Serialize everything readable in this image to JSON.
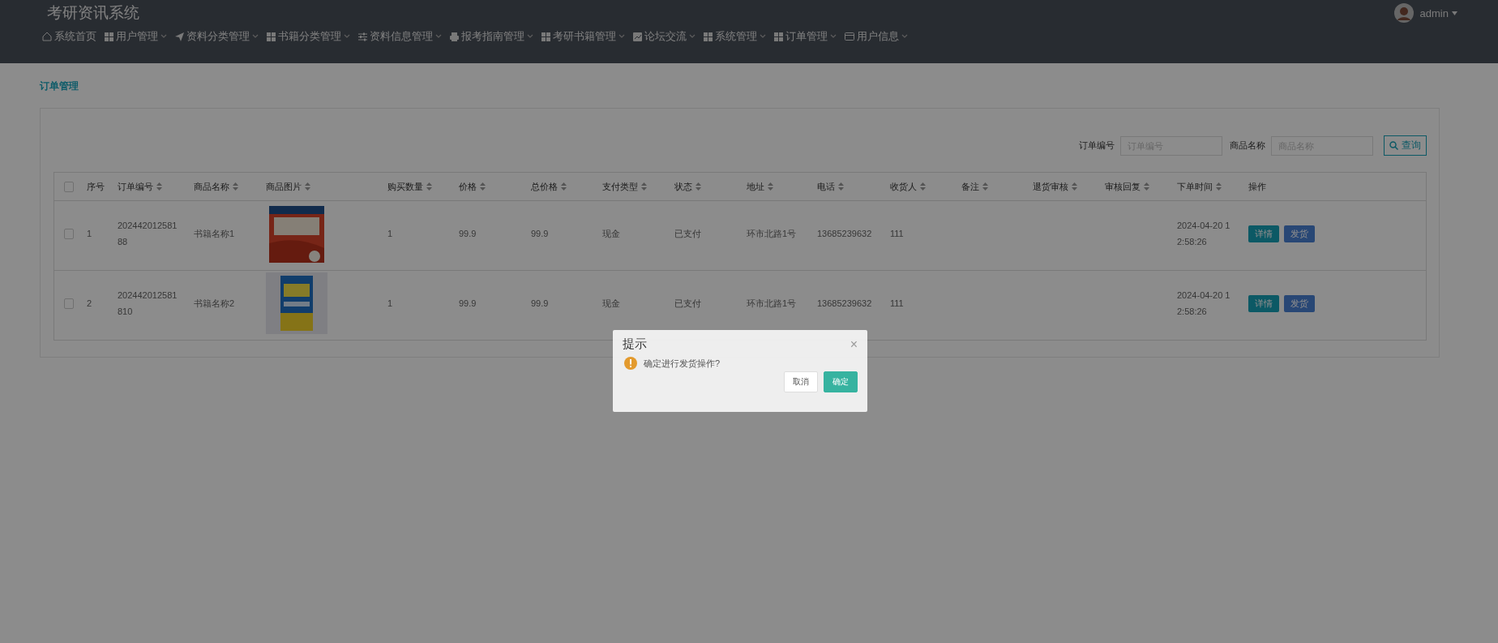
{
  "app": {
    "title": "考研资讯系统",
    "user": "admin"
  },
  "nav": [
    {
      "label": "系统首页",
      "dropdown": false
    },
    {
      "label": "用户管理",
      "dropdown": true
    },
    {
      "label": "资料分类管理",
      "dropdown": true
    },
    {
      "label": "书籍分类管理",
      "dropdown": true
    },
    {
      "label": "资料信息管理",
      "dropdown": true
    },
    {
      "label": "报考指南管理",
      "dropdown": true
    },
    {
      "label": "考研书籍管理",
      "dropdown": true
    },
    {
      "label": "论坛交流",
      "dropdown": true
    },
    {
      "label": "系统管理",
      "dropdown": true
    },
    {
      "label": "订单管理",
      "dropdown": true
    },
    {
      "label": "用户信息",
      "dropdown": true
    }
  ],
  "breadcrumb": "订单管理",
  "search": {
    "fields": [
      {
        "label": "订单编号",
        "placeholder": "订单编号"
      },
      {
        "label": "商品名称",
        "placeholder": "商品名称"
      }
    ],
    "button": "查询"
  },
  "table": {
    "select_all": {
      "checked": false
    },
    "columns": [
      {
        "label": "序号",
        "sortable": false
      },
      {
        "label": "订单编号",
        "sortable": true
      },
      {
        "label": "商品名称",
        "sortable": true
      },
      {
        "label": "商品图片",
        "sortable": true
      },
      {
        "label": "购买数量",
        "sortable": true
      },
      {
        "label": "价格",
        "sortable": true
      },
      {
        "label": "总价格",
        "sortable": true
      },
      {
        "label": "支付类型",
        "sortable": true
      },
      {
        "label": "状态",
        "sortable": true
      },
      {
        "label": "地址",
        "sortable": true
      },
      {
        "label": "电话",
        "sortable": true
      },
      {
        "label": "收货人",
        "sortable": true
      },
      {
        "label": "备注",
        "sortable": true
      },
      {
        "label": "退货审核",
        "sortable": true
      },
      {
        "label": "审核回复",
        "sortable": true
      },
      {
        "label": "下单时间",
        "sortable": true
      },
      {
        "label": "操作",
        "sortable": false
      }
    ],
    "rows": [
      {
        "checked": false,
        "index": "1",
        "order_no": "20244201258188",
        "name": "书籍名称1",
        "qty": "1",
        "price": "99.9",
        "total": "99.9",
        "pay": "现金",
        "status": "已支付",
        "address": "环市北路1号",
        "phone": "13685239632",
        "receiver": "111",
        "time": "2024-04-20 12:58:26",
        "actions": [
          "详情",
          "发货"
        ]
      },
      {
        "checked": false,
        "index": "2",
        "order_no": "202442012581810",
        "name": "书籍名称2",
        "qty": "1",
        "price": "99.9",
        "total": "99.9",
        "pay": "现金",
        "status": "已支付",
        "address": "环市北路1号",
        "phone": "13685239632",
        "receiver": "111",
        "time": "2024-04-20 12:58:26",
        "actions": [
          "详情",
          "发货"
        ]
      }
    ]
  },
  "dialog": {
    "title": "提示",
    "close": "×",
    "message": "确定进行发货操作?",
    "buttons": [
      {
        "label": "取消",
        "kind": "cancel"
      },
      {
        "label": "确定",
        "kind": "confirm"
      }
    ]
  }
}
